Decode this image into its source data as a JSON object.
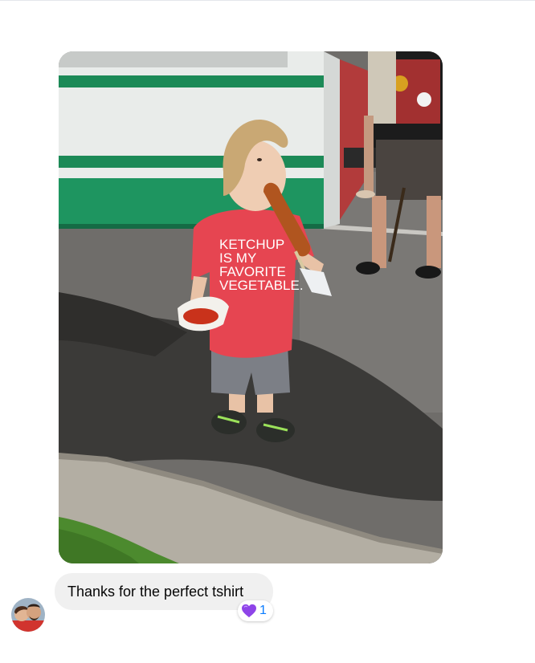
{
  "photo": {
    "alt": "Toddler eating a corn dog wearing a red t-shirt",
    "shirt_lines": [
      "KETCHUP",
      "IS MY",
      "FAVORITE",
      "VEGETABLE."
    ]
  },
  "message": {
    "text": "Thanks for the perfect tshirt"
  },
  "reaction": {
    "emoji": "purple-heart",
    "count": "1",
    "color": "#8e44e8"
  },
  "colors": {
    "bubble": "#f0f0f0",
    "accent": "#0a7cff"
  }
}
